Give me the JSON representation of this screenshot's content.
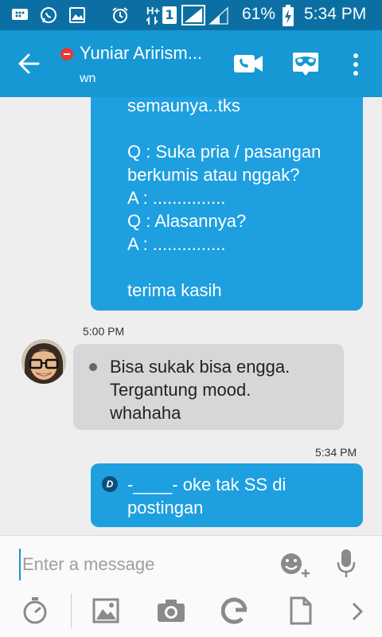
{
  "status_bar": {
    "battery": "61%",
    "time": "5:34 PM",
    "network": "H+",
    "sim": "1"
  },
  "header": {
    "contact_name": "Yuniar Arirism...",
    "subtitle": "wn"
  },
  "messages": {
    "m1_lines": [
      "semaunya..tks",
      "",
      "Q : Suka pria / pasangan",
      "berkumis atau nggak?",
      "A : ...............",
      "Q : Alasannya?",
      "A : ...............",
      "",
      "terima kasih"
    ],
    "m2_time": "5:00 PM",
    "m2_lines": [
      "Bisa sukak bisa engga.",
      "Tergantung mood.",
      "whahaha"
    ],
    "m3_time": "5:34 PM",
    "m3_badge": "D",
    "m3_lines": [
      "-____- oke tak SS di",
      "postingan"
    ]
  },
  "compose": {
    "placeholder": "Enter a message"
  },
  "colors": {
    "status_bar": "#0c6fa3",
    "app_bar": "#1598d4",
    "outgoing_bubble": "#1e9fe0",
    "incoming_bubble": "#d7d7d7"
  }
}
